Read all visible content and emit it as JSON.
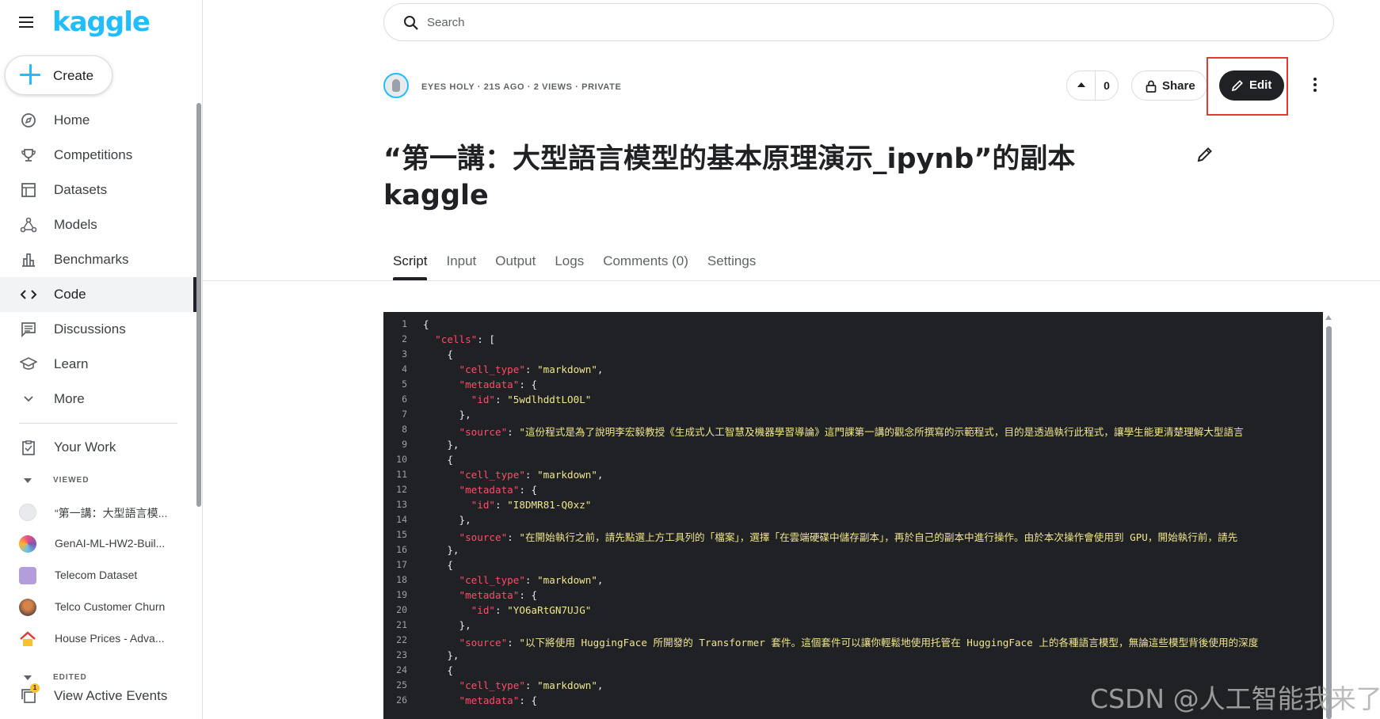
{
  "sidebar": {
    "logo": "kaggle",
    "create_label": "Create",
    "nav": [
      {
        "label": "Home",
        "icon": "compass-icon"
      },
      {
        "label": "Competitions",
        "icon": "trophy-icon"
      },
      {
        "label": "Datasets",
        "icon": "table-icon"
      },
      {
        "label": "Models",
        "icon": "models-icon"
      },
      {
        "label": "Benchmarks",
        "icon": "bar-chart-icon"
      },
      {
        "label": "Code",
        "icon": "code-icon",
        "active": true
      },
      {
        "label": "Discussions",
        "icon": "comment-icon"
      },
      {
        "label": "Learn",
        "icon": "school-icon"
      },
      {
        "label": "More",
        "icon": "chevron-down-icon"
      }
    ],
    "your_work": "Your Work",
    "viewed_label": "VIEWED",
    "recent": [
      "“第一講：大型語言模...",
      "GenAI-ML-HW2-Buil...",
      "Telecom Dataset",
      "Telco Customer Churn",
      "House Prices - Adva..."
    ],
    "edited_label": "EDITED",
    "view_active_events": "View Active Events",
    "badge_count": "1"
  },
  "search": {
    "placeholder": "Search"
  },
  "notebook": {
    "meta": "EYES HOLY · 21S AGO · 2 VIEWS · PRIVATE",
    "vote_count": "0",
    "share_label": "Share",
    "edit_label": "Edit",
    "title_line1": "“第一講：大型語言模型的基本原理演示_ipynb”的副本",
    "title_line2": "kaggle"
  },
  "tabs": [
    "Script",
    "Input",
    "Output",
    "Logs",
    "Comments (0)",
    "Settings"
  ],
  "active_tab": "Script",
  "code_lines": [
    "{",
    "  \"cells\": [",
    "    {",
    "      \"cell_type\": \"markdown\",",
    "      \"metadata\": {",
    "        \"id\": \"5wdlhddtLO0L\"",
    "      },",
    "      \"source\": \"這份程式是為了說明李宏毅教授《生成式人工智慧及機器學習導論》這門課第一講的觀念所撰寫的示範程式，目的是透過執行此程式，讓學生能更清楚理解大型語言",
    "    },",
    "    {",
    "      \"cell_type\": \"markdown\",",
    "      \"metadata\": {",
    "        \"id\": \"I8DMR81-Q0xz\"",
    "      },",
    "      \"source\": \"在開始執行之前，請先點選上方工具列的「檔案」，選擇「在雲端硬碟中儲存副本」，再於自己的副本中進行操作。由於本次操作會使用到 GPU，開始執行前，請先",
    "    },",
    "    {",
    "      \"cell_type\": \"markdown\",",
    "      \"metadata\": {",
    "        \"id\": \"YO6aRtGN7UJG\"",
    "      },",
    "      \"source\": \"以下將使用 HuggingFace 所開發的 Transformer 套件。這個套件可以讓你輕鬆地使用托管在 HuggingFace 上的各種語言模型，無論這些模型背後使用的深度",
    "    },",
    "    {",
    "      \"cell_type\": \"markdown\",",
    "      \"metadata\": {"
  ],
  "watermark": "CSDN @人工智能我来了",
  "colors": {
    "brand": "#20beff",
    "code_bg": "#202124",
    "key": "#ff4c6a",
    "string": "#f0e68c",
    "highlight_box": "#e53935"
  }
}
